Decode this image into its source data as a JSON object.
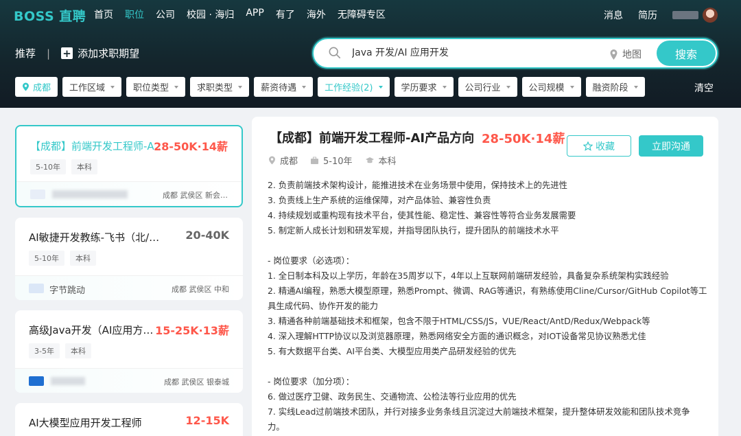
{
  "header": {
    "logo": "BOSS 直聘",
    "nav": [
      "首页",
      "职位",
      "公司",
      "校园 · 海归",
      "APP",
      "有了",
      "海外",
      "无障碍专区"
    ],
    "right": [
      "消息",
      "简历"
    ]
  },
  "search": {
    "recommend": "推荐",
    "separator": "|",
    "add_expect": "添加求职期望",
    "query": "Java 开发/AI 应用开发",
    "map_label": "地图",
    "button": "搜索"
  },
  "filters": {
    "items": [
      {
        "label": "成都",
        "highlight": true
      },
      {
        "label": "工作区域",
        "highlight": false
      },
      {
        "label": "职位类型",
        "highlight": false
      },
      {
        "label": "求职类型",
        "highlight": false
      },
      {
        "label": "薪资待遇",
        "highlight": false
      },
      {
        "label": "工作经验(2)",
        "highlight": true
      },
      {
        "label": "学历要求",
        "highlight": false
      },
      {
        "label": "公司行业",
        "highlight": false
      },
      {
        "label": "公司规模",
        "highlight": false
      },
      {
        "label": "融资阶段",
        "highlight": false
      }
    ],
    "clear": "清空"
  },
  "jobs": [
    {
      "title": "【成都】前端开发工程师-AI产品方向",
      "salary": "28-50K·14薪",
      "tags": [
        "5-10年",
        "本科"
      ],
      "company": "",
      "location": "成都 武侯区 新会…",
      "selected": true
    },
    {
      "title": "AI敏捷开发教练-飞书（北/上/杭/深/成）",
      "salary": "20-40K",
      "tags": [
        "5-10年",
        "本科"
      ],
      "company": "字节跳动",
      "location": "成都 武侯区 中和",
      "selected": false
    },
    {
      "title": "高级Java开发（AI应用方向）",
      "salary": "15-25K·13薪",
      "tags": [
        "3-5年",
        "本科"
      ],
      "company": "",
      "location": "成都 武侯区 银泰城",
      "selected": false
    },
    {
      "title": "AI大模型应用开发工程师",
      "salary": "12-15K",
      "tags": [],
      "company": "",
      "location": "",
      "selected": false
    }
  ],
  "detail": {
    "title": "【成都】前端开发工程师-AI产品方向",
    "salary": "28-50K·14薪",
    "city": "成都",
    "experience": "5-10年",
    "degree": "本科",
    "fav": "收藏",
    "chat": "立即沟通",
    "lines": [
      "2. 负责前端技术架构设计，能推进技术在业务场景中使用，保持技术上的先进性",
      "3. 负责线上生产系统的运维保障，对产品体验、兼容性负责",
      "4. 持续规划或重构现有技术平台，使其性能、稳定性、兼容性等符合业务发展需要",
      "5. 制定新人成长计划和研发军规，并指导团队执行，提升团队的前端技术水平",
      "",
      "- 岗位要求（必选项）：",
      "1. 全日制本科及以上学历，年龄在35周岁以下，4年以上互联网前端研发经验，具备复杂系统架构实践经验",
      "2. 精通AI编程，熟悉大模型原理，熟悉Prompt、微调、RAG等通识，有熟练使用Cline/Cursor/GitHub Copilot等工",
      "具生成代码、协作开发的能力",
      "3. 精通各种前端基础技术和框架，包含不限于HTML/CSS/JS，VUE/React/AntD/Redux/Webpack等",
      "4. 深入理解HTTP协议以及浏览器原理，熟悉网络安全方面的通识概念，对IOT设备常见协议熟悉尤佳",
      "5. 有大数据平台类、AI平台类、大模型应用类产品研发经验的优先",
      "",
      "- 岗位要求（加分项）：",
      "6. 做过医疗卫健、政务民生、交通物流、公检法等行业应用的优先",
      "7. 实线Lead过前端技术团队，并行对接多业务条线且沉淀过大前端技术框架，提升整体研发效能和团队技术竞争",
      "力。"
    ]
  },
  "colors": {
    "accent": "#34c8c9",
    "salary": "#fe574a",
    "header_bg": "#14262d"
  }
}
